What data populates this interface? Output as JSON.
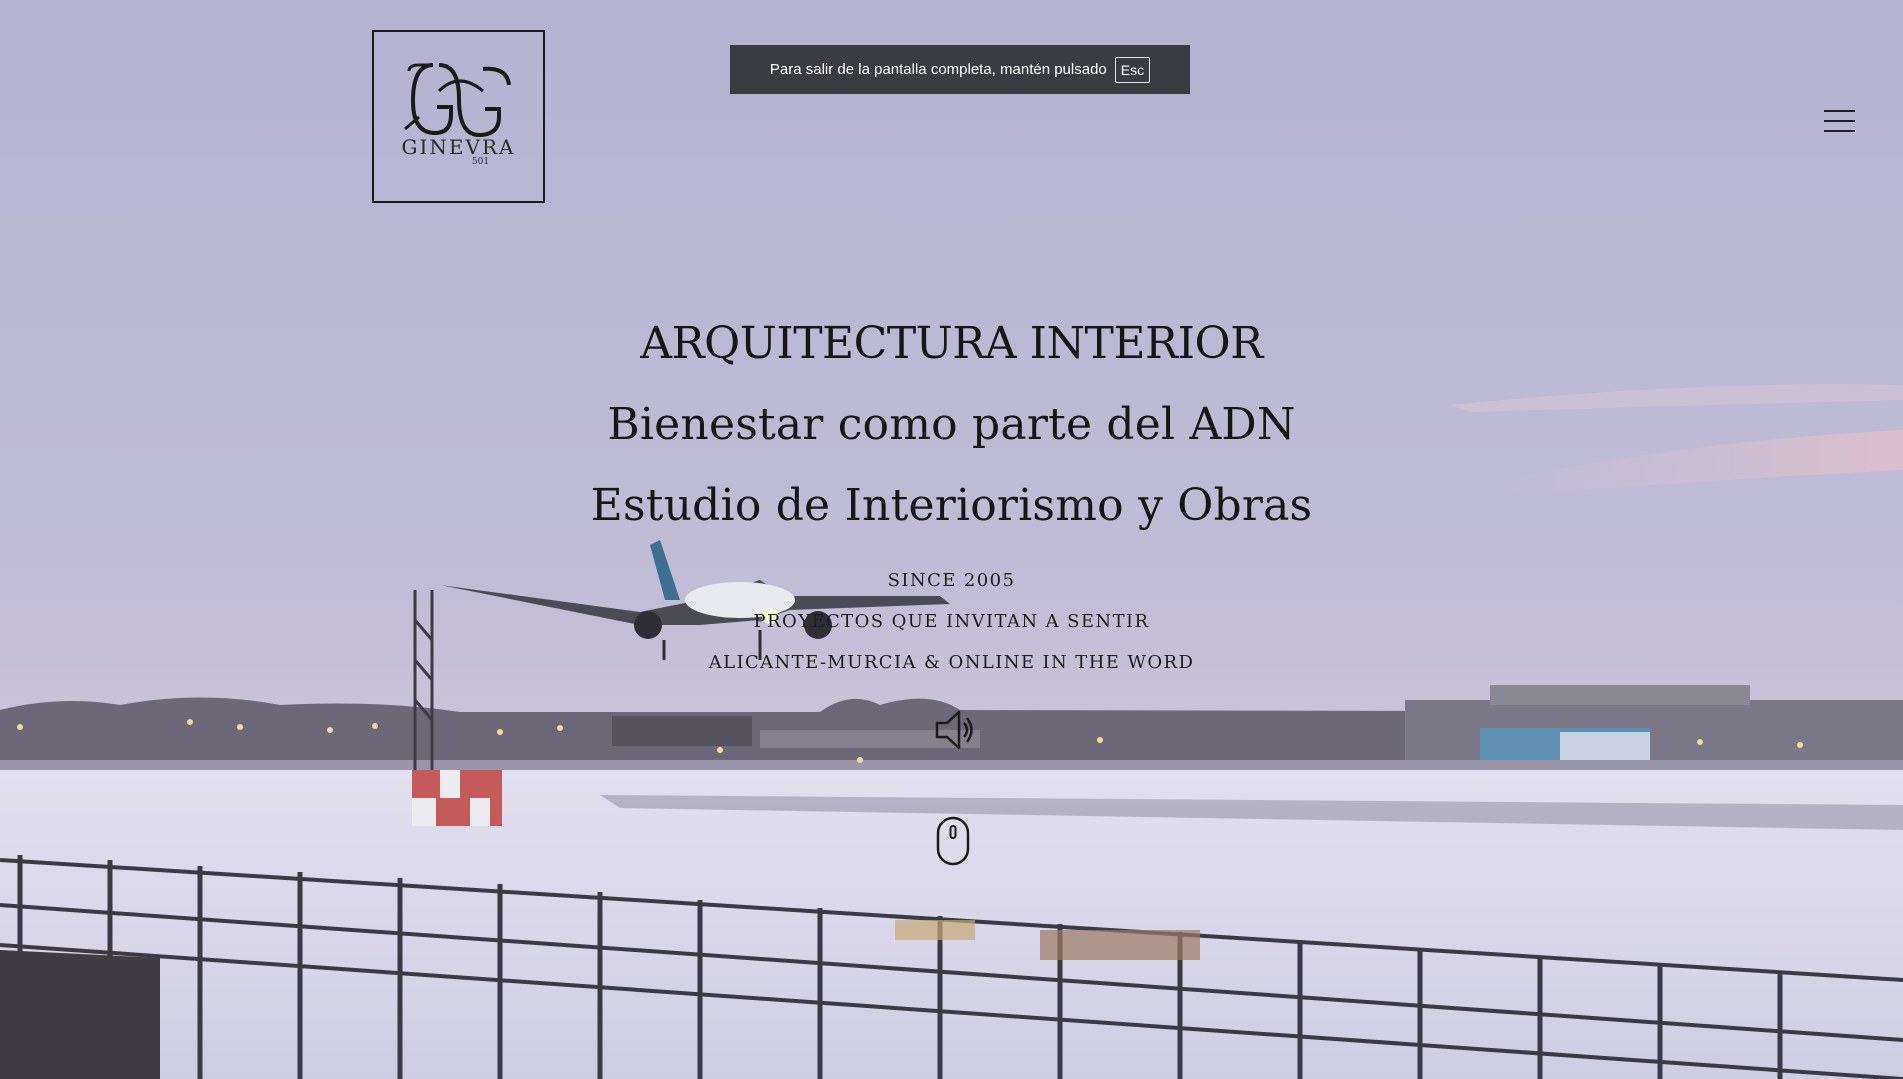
{
  "brand": {
    "wordmark": "GINEVRA",
    "number": "501"
  },
  "fullscreen_notice": {
    "text": "Para salir de la pantalla completa, mantén pulsado",
    "key": "Esc"
  },
  "hero": {
    "headlines": [
      "ARQUITECTURA INTERIOR",
      "Bienestar como parte del ADN",
      "Estudio de Interiorismo y Obras"
    ],
    "taglines": [
      "SINCE 2005",
      "PROYECTOS QUE INVITAN A SENTIR",
      "ALICANTE-MURCIA & ONLINE IN THE WORD"
    ]
  },
  "icons": {
    "menu": "hamburger-menu-icon",
    "sound": "speaker-icon",
    "scroll": "mouse-scroll-icon"
  },
  "colors": {
    "sky_top": "#b3b2cf",
    "sky_bottom": "#cbc6da",
    "snow": "#dcdaea",
    "text": "#161616",
    "toast_bg": "#3b3c42"
  }
}
